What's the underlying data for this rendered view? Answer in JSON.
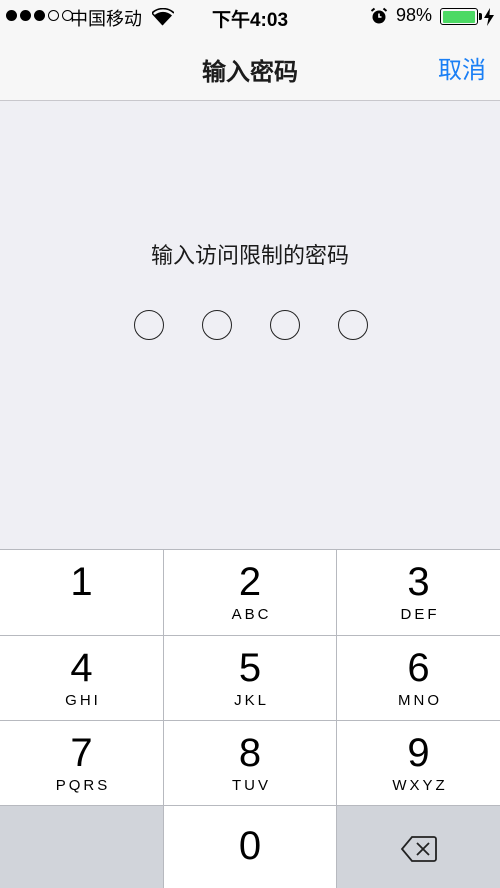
{
  "status_bar": {
    "carrier": "中国移动",
    "time": "下午4:03",
    "battery_percent": "98%",
    "battery_level": 0.98,
    "signal_bars_filled": 3,
    "signal_bars_total": 5
  },
  "nav": {
    "title": "输入密码",
    "cancel_label": "取消"
  },
  "passcode": {
    "prompt": "输入访问限制的密码",
    "digits_total": 4,
    "digits_entered": 0
  },
  "keypad": {
    "keys": [
      {
        "digit": "1",
        "letters": ""
      },
      {
        "digit": "2",
        "letters": "ABC"
      },
      {
        "digit": "3",
        "letters": "DEF"
      },
      {
        "digit": "4",
        "letters": "GHI"
      },
      {
        "digit": "5",
        "letters": "JKL"
      },
      {
        "digit": "6",
        "letters": "MNO"
      },
      {
        "digit": "7",
        "letters": "PQRS"
      },
      {
        "digit": "8",
        "letters": "TUV"
      },
      {
        "digit": "9",
        "letters": "WXYZ"
      },
      {
        "digit": "0",
        "letters": ""
      }
    ]
  },
  "colors": {
    "accent": "#1a7ff5",
    "battery": "#4cd964",
    "background": "#efeff4",
    "key": "#ffffff",
    "key_function": "#d1d4da"
  }
}
